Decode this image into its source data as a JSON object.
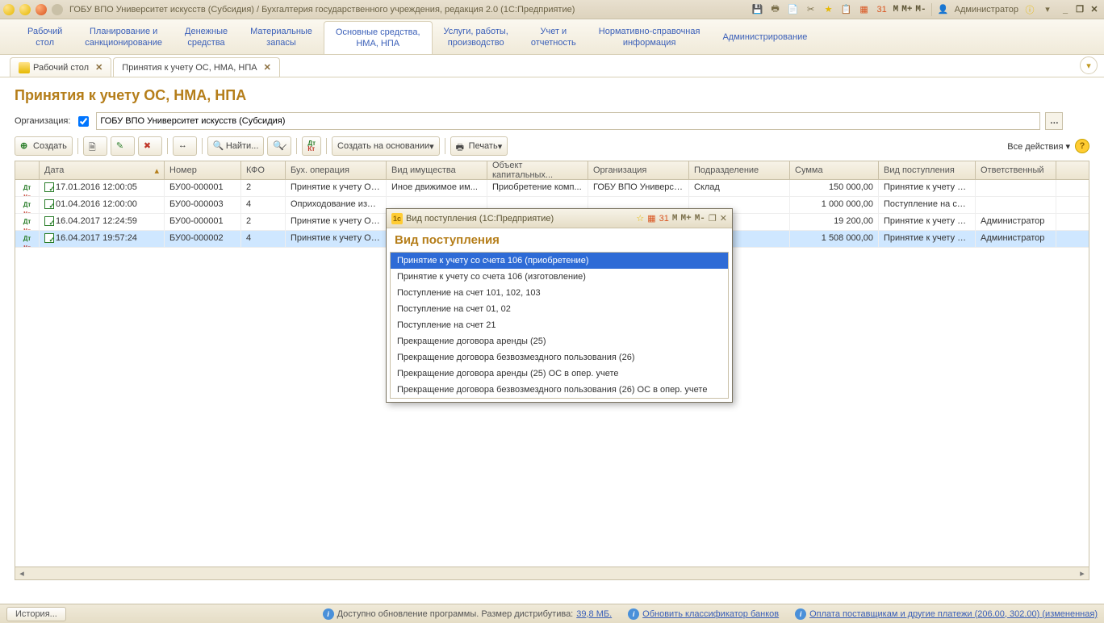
{
  "titlebar": {
    "title": "ГОБУ ВПО Университет искусств (Субсидия) / Бухгалтерия государственного учреждения, редакция 2.0  (1С:Предприятие)",
    "user": "Администратор"
  },
  "mainnav": [
    "Рабочий\nстол",
    "Планирование и\nсанкционирование",
    "Денежные\nсредства",
    "Материальные\nзапасы",
    "Основные средства,\nНМА, НПА",
    "Услуги, работы,\nпроизводство",
    "Учет и\nотчетность",
    "Нормативно-справочная\nинформация",
    "Администрирование"
  ],
  "mainnav_active": 4,
  "sectabs": [
    {
      "label": "Рабочий стол"
    },
    {
      "label": "Принятия к учету ОС, НМА, НПА"
    }
  ],
  "page": {
    "heading": "Принятия к учету ОС, НМА, НПА",
    "filter_label": "Организация:",
    "filter_value": "ГОБУ ВПО Университет искусств (Субсидия)"
  },
  "toolbar": {
    "create": "Создать",
    "find": "Найти...",
    "create_based": "Создать на основании",
    "print": "Печать",
    "all_actions": "Все действия"
  },
  "columns": [
    "",
    "Дата",
    "Номер",
    "КФО",
    "Бух. операция",
    "Вид имущества",
    "Объект капитальных...",
    "Организация",
    "Подразделение",
    "Сумма",
    "Вид поступления",
    "Ответственный"
  ],
  "rows": [
    {
      "date": "17.01.2016 12:00:05",
      "num": "БУ00-000001",
      "kfo": "2",
      "op": "Принятие к учету ОС...",
      "kind": "Иное движимое им...",
      "obj": "Приобретение комп...",
      "org": "ГОБУ ВПО Универси...",
      "dept": "Склад",
      "sum": "150 000,00",
      "rcpt": "Принятие к учету со ...",
      "resp": ""
    },
    {
      "date": "01.04.2016 12:00:00",
      "num": "БУ00-000003",
      "kfo": "4",
      "op": "Оприходование изли...",
      "kind": "",
      "obj": "",
      "org": "",
      "dept": "",
      "sum": "1 000 000,00",
      "rcpt": "Поступление на счет...",
      "resp": ""
    },
    {
      "date": "16.04.2017 12:24:59",
      "num": "БУ00-000001",
      "kfo": "2",
      "op": "Принятие к учету ОС...",
      "kind": "",
      "obj": "",
      "org": "",
      "dept": "",
      "sum": "19 200,00",
      "rcpt": "Принятие к учету со ...",
      "resp": "Администратор"
    },
    {
      "date": "16.04.2017 19:57:24",
      "num": "БУ00-000002",
      "kfo": "4",
      "op": "Принятие к учету ОС...",
      "kind": "",
      "obj": "",
      "org": "",
      "dept": "",
      "sum": "1 508 000,00",
      "rcpt": "Принятие к учету со ...",
      "resp": "Администратор"
    }
  ],
  "selected_row": 3,
  "popup": {
    "bar_title": "Вид поступления  (1С:Предприятие)",
    "heading": "Вид поступления",
    "items": [
      "Принятие к учету со счета 106 (приобретение)",
      "Принятие к учету со счета 106 (изготовление)",
      "Поступление на счет 101, 102, 103",
      "Поступление на счет 01, 02",
      "Поступление на счет 21",
      "Прекращение договора аренды (25)",
      "Прекращение договора безвозмездного пользования (26)",
      "Прекращение договора аренды (25) ОС в опер. учете",
      "Прекращение договора безвозмездного пользования (26) ОС в опер. учете"
    ],
    "selected": 0
  },
  "status": {
    "history": "История...",
    "msg1_pre": "Доступно обновление программы. Размер дистрибутива: ",
    "msg1_size": "39,8 МБ.",
    "msg2": "Обновить классификатор банков",
    "msg3": "Оплата поставщикам и другие платежи (206.00, 302.00) (измененная)"
  }
}
